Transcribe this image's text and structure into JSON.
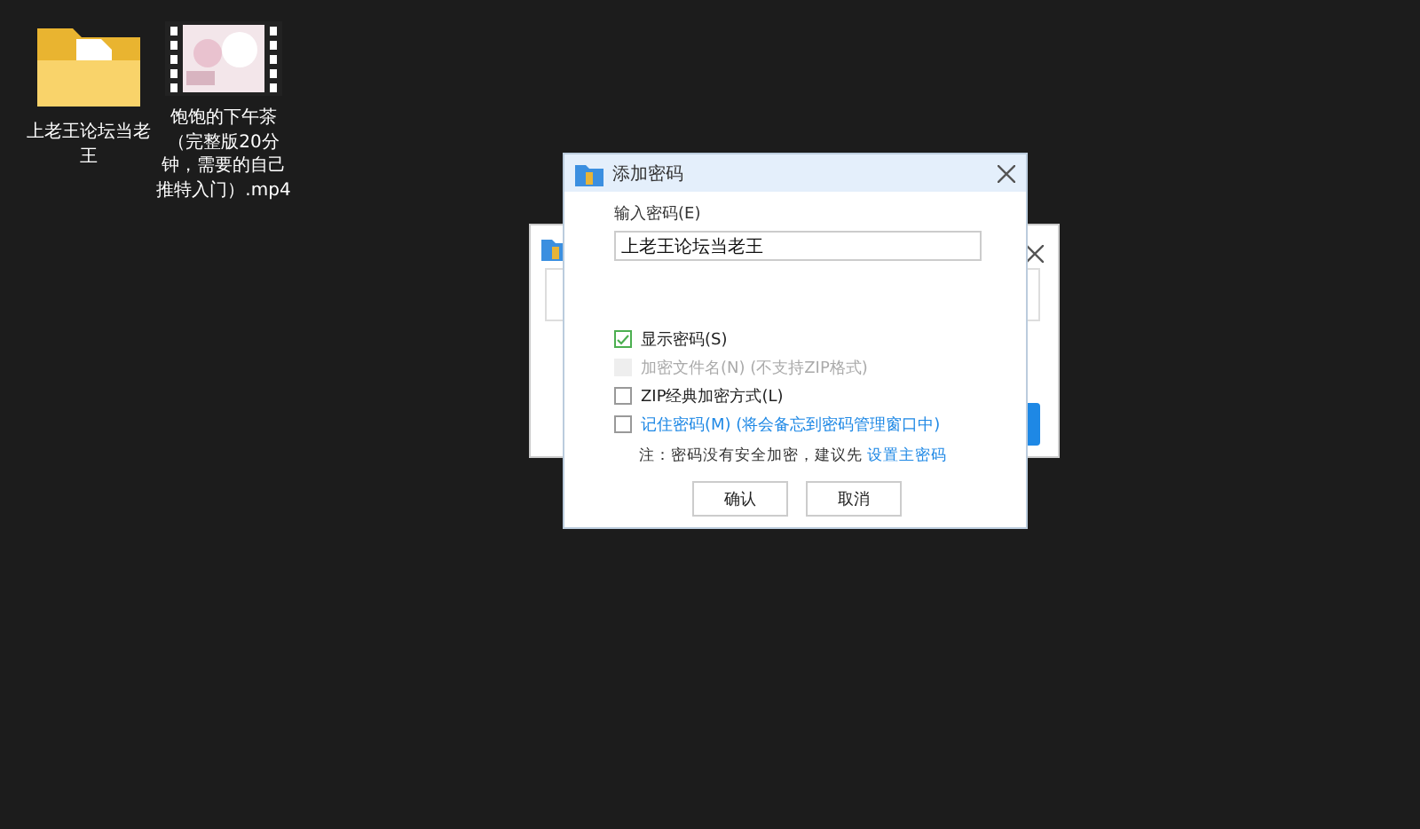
{
  "desktop_items": [
    {
      "kind": "folder",
      "label": "上老王论坛当老王"
    },
    {
      "kind": "video",
      "label": "饱饱的下午茶（完整版20分钟，需要的自己推特入门）.mp4"
    }
  ],
  "dialog": {
    "title": "添加密码",
    "password_label": "输入密码(E)",
    "password_value": "上老王论坛当老王",
    "options": [
      {
        "label": "显示密码(S)",
        "checked": true,
        "disabled": false,
        "link": false
      },
      {
        "label": "加密文件名(N) (不支持ZIP格式)",
        "checked": false,
        "disabled": true,
        "link": false
      },
      {
        "label": "ZIP经典加密方式(L)",
        "checked": false,
        "disabled": false,
        "link": false
      },
      {
        "label": "记住密码(M) (将会备忘到密码管理窗口中)",
        "checked": false,
        "disabled": false,
        "link": true
      }
    ],
    "note": "注：密码没有安全加密，建议先",
    "note_link": "设置主密码",
    "buttons": [
      "确认",
      "取消"
    ]
  }
}
